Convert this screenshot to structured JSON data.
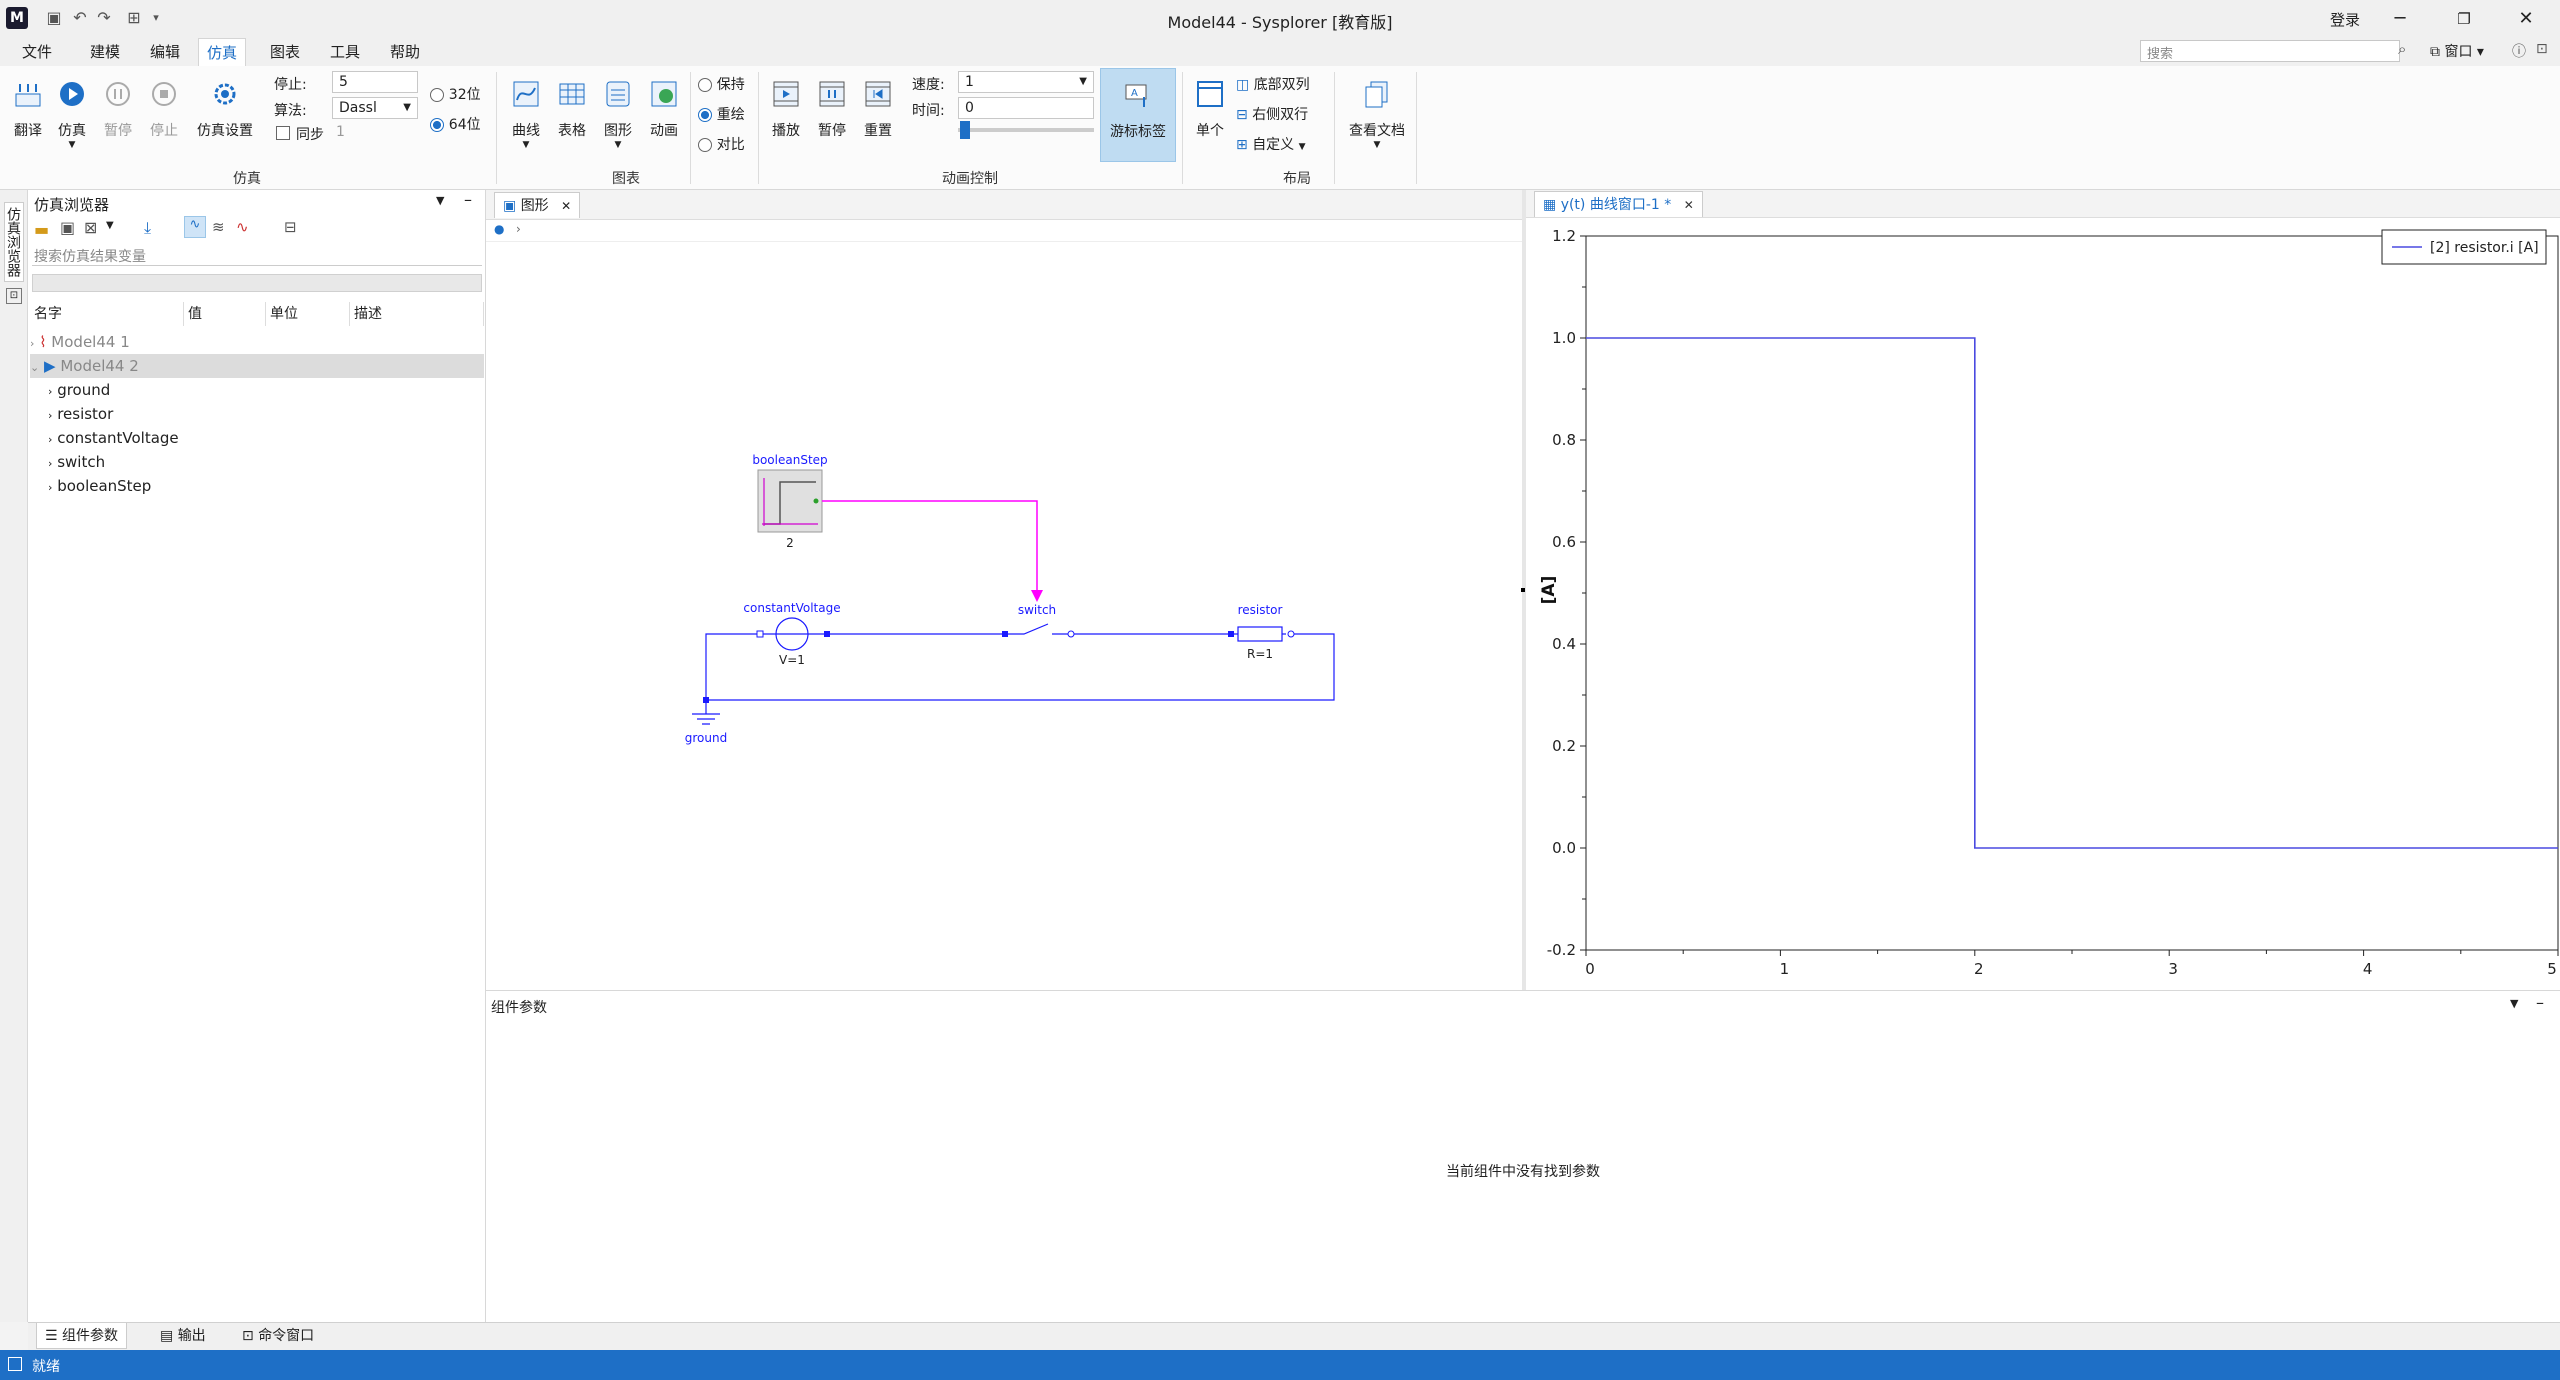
{
  "window": {
    "title": "Model44 - Sysplorer [教育版]",
    "login": "登录",
    "logo": "M",
    "search_placeholder": "搜索",
    "window_menu": "窗口"
  },
  "menu": [
    "文件",
    "建模",
    "编辑",
    "仿真",
    "图表",
    "工具",
    "帮助"
  ],
  "menu_active": "仿真",
  "ribbon": {
    "sim_buttons": [
      "翻译",
      "仿真",
      "暂停",
      "停止",
      "仿真设置"
    ],
    "stop_label": "停止:",
    "stop_value": "5",
    "algo_label": "算法:",
    "algo_value": "Dassl",
    "sync_label": "同步",
    "sync_value": "1",
    "bit32": "32位",
    "bit64": "64位",
    "group_sim": "仿真",
    "chart_buttons": [
      "曲线",
      "表格",
      "图形",
      "动画"
    ],
    "mode_keep": "保持",
    "mode_redraw": "重绘",
    "mode_compare": "对比",
    "group_chart": "图表",
    "anim_buttons": [
      "播放",
      "暂停",
      "重置"
    ],
    "speed_label": "速度:",
    "speed_value": "1",
    "time_label": "时间:",
    "time_value": "0",
    "cursor_label": "游标标签",
    "group_anim": "动画控制",
    "layout_single": "单个",
    "layout_bottom": "底部双列",
    "layout_right": "右侧双行",
    "layout_custom": "自定义",
    "group_layout": "布局",
    "view_docs": "查看文档"
  },
  "browser": {
    "strip_label": "仿真浏览器",
    "title": "仿真浏览器",
    "search_placeholder": "搜索仿真结果变量",
    "columns": [
      "名字",
      "值",
      "单位",
      "描述"
    ],
    "results": [
      "Model44 1",
      "Model44 2"
    ],
    "children": [
      "ground",
      "resistor",
      "constantVoltage",
      "switch",
      "booleanStep"
    ]
  },
  "diagram_tab": "图形",
  "plot_tab": "y(t) 曲线窗口-1 *",
  "diagram": {
    "boolean_step": "booleanStep",
    "boolean_step_param": "2",
    "constant_voltage": "constantVoltage",
    "voltage_param": "V=1",
    "switch": "switch",
    "resistor": "resistor",
    "resistor_param": "R=1",
    "ground": "ground"
  },
  "chart_data": {
    "type": "line",
    "series": [
      {
        "name": "[2] resistor.i [A]",
        "x": [
          0,
          2,
          2,
          5
        ],
        "values": [
          1.0,
          1.0,
          0.0,
          0.0
        ]
      }
    ],
    "xlim": [
      0,
      5
    ],
    "ylim": [
      -0.2,
      1.2
    ],
    "xticks": [
      "0",
      "1",
      "2",
      "3",
      "4",
      "5"
    ],
    "yticks": [
      "-0.2",
      "0.0",
      "0.2",
      "0.4",
      "0.6",
      "0.8",
      "1.0",
      "1.2"
    ],
    "ylabel": "[A]",
    "legend_position": "top-right",
    "grid": true,
    "line_color": "#4a4ae0"
  },
  "params": {
    "title": "组件参数",
    "empty_message": "当前组件中没有找到参数"
  },
  "bottom_tabs": [
    "组件参数",
    "输出",
    "命令窗口"
  ],
  "status": "就绪"
}
